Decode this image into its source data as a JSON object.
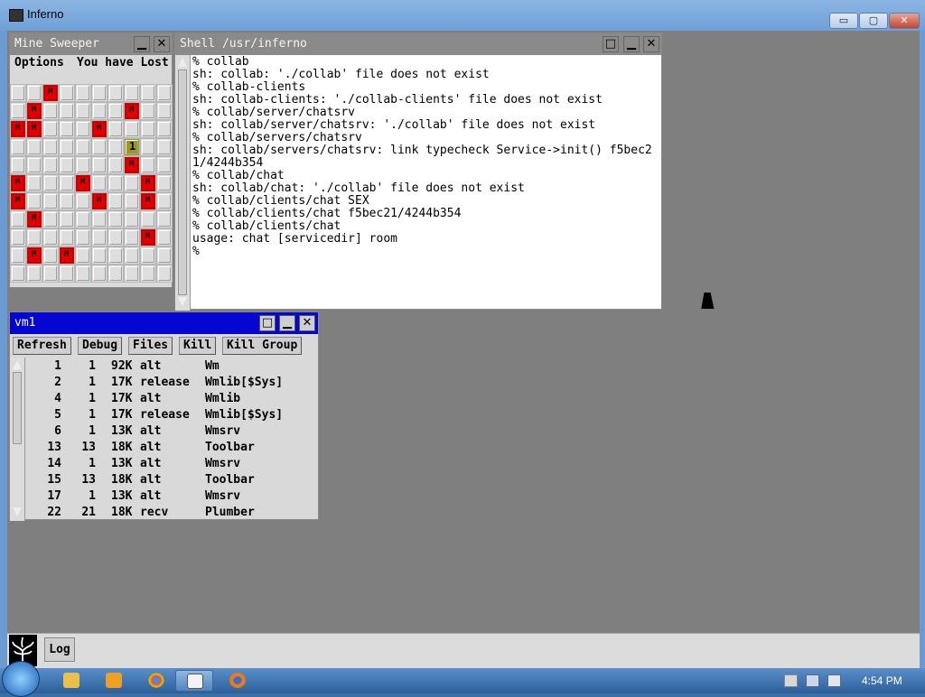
{
  "host": {
    "title": "Inferno",
    "buttons": {
      "minimize": "▭",
      "maximize": "▢",
      "close": "✕"
    }
  },
  "minesweeper": {
    "title": "Mine Sweeper",
    "menu_options": "Options",
    "status": "You have Lost",
    "mine_glyph": "M",
    "grid": [
      [
        "",
        "",
        "M",
        "",
        "",
        "",
        "",
        "",
        "",
        ""
      ],
      [
        "",
        "M",
        "",
        "",
        "",
        "",
        "",
        "M",
        "",
        ""
      ],
      [
        "M",
        "M",
        "",
        "",
        "",
        "M",
        "",
        "",
        "",
        ""
      ],
      [
        "",
        "",
        "",
        "",
        "",
        "",
        "",
        "1",
        "",
        ""
      ],
      [
        "",
        "",
        "",
        "",
        "",
        "",
        "",
        "M",
        "",
        ""
      ],
      [
        "M",
        "",
        "",
        "",
        "M",
        "",
        "",
        "",
        "M",
        ""
      ],
      [
        "M",
        "",
        "",
        "",
        "",
        "M",
        "",
        "",
        "M",
        ""
      ],
      [
        "",
        "M",
        "",
        "",
        "",
        "",
        "",
        "",
        "",
        ""
      ],
      [
        "",
        "",
        "",
        "",
        "",
        "",
        "",
        "",
        "M",
        ""
      ],
      [
        "",
        "M",
        "",
        "M",
        "",
        "",
        "",
        "",
        "",
        ""
      ],
      [
        "",
        "",
        "",
        "",
        "",
        "",
        "",
        "",
        "",
        ""
      ]
    ]
  },
  "shell": {
    "title": "Shell /usr/inferno",
    "lines": [
      "% collab",
      "sh: collab: './collab' file does not exist",
      "% collab-clients",
      "sh: collab-clients: './collab-clients' file does not exist",
      "% collab/server/chatsrv",
      "sh: collab/server/chatsrv: './collab' file does not exist",
      "% collab/servers/chatsrv",
      "sh: collab/servers/chatsrv: link typecheck Service->init() f5bec2",
      "1/4244b354",
      "% collab/chat",
      "sh: collab/chat: './collab' file does not exist",
      "% collab/clients/chat SEX",
      "% collab/clients/chat f5bec21/4244b354",
      "% collab/clients/chat",
      "usage: chat [servicedir] room",
      "%"
    ]
  },
  "vm": {
    "title": "vm1",
    "buttons": [
      "Refresh",
      "Debug",
      "Files",
      "Kill",
      "Kill Group"
    ],
    "rows": [
      [
        "1",
        "1",
        "92K",
        "alt",
        "Wm"
      ],
      [
        "2",
        "1",
        "17K",
        "release",
        "Wmlib[$Sys]"
      ],
      [
        "4",
        "1",
        "17K",
        "alt",
        "Wmlib"
      ],
      [
        "5",
        "1",
        "17K",
        "release",
        "Wmlib[$Sys]"
      ],
      [
        "6",
        "1",
        "13K",
        "alt",
        "Wmsrv"
      ],
      [
        "13",
        "13",
        "18K",
        "alt",
        "Toolbar"
      ],
      [
        "14",
        "1",
        "13K",
        "alt",
        "Wmsrv"
      ],
      [
        "15",
        "13",
        "18K",
        "alt",
        "Toolbar"
      ],
      [
        "17",
        "1",
        "13K",
        "alt",
        "Wmsrv"
      ],
      [
        "22",
        "21",
        "18K",
        "recv",
        "Plumber"
      ]
    ]
  },
  "inferno_bar": {
    "log_label": "Log"
  },
  "taskbar": {
    "clock": "4:54 PM"
  },
  "colors": {
    "vm_title": "#0606d3",
    "mine_red": "#e00000",
    "desktop_grey": "#7f7f7f"
  }
}
